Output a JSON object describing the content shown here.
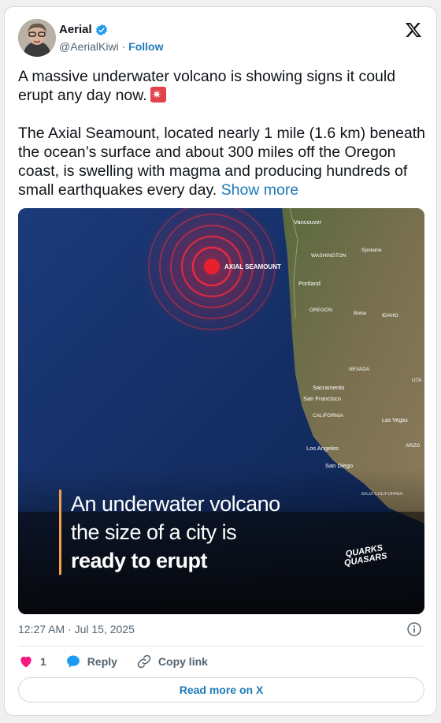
{
  "author": {
    "name": "Aerial",
    "handle": "@AerialKiwi",
    "separator": "·",
    "follow_label": "Follow"
  },
  "post": {
    "paragraph1": "A massive underwater volcano is showing signs it could erupt any day now.",
    "paragraph2": "The Axial Seamount, located nearly 1 mile (1.6 km) beneath the ocean’s surface and about 300 miles off the Oregon coast, is swelling with magma and producing hundreds of small earthquakes every day.",
    "show_more_label": "Show more",
    "timestamp": "12:27 AM · Jul 15, 2025"
  },
  "media": {
    "map_labels": {
      "seamount": "AXIAL SEAMOUNT",
      "vancouver": "Vancouver",
      "washington": "WASHINGTON",
      "spokane": "Spokane",
      "portland": "Portland",
      "oregon": "OREGON",
      "boise": "Boise",
      "idaho": "IDAHO",
      "nevada": "NEVADA",
      "utah": "UTA",
      "sacramento": "Sacramento",
      "san_francisco": "San Francisco",
      "california": "CALIFORNIA",
      "las_vegas": "Las Vegas",
      "arizona": "ARIZO",
      "los_angeles": "Los Angeles",
      "san_diego": "San Diego",
      "baja": "BAJA CALIFORNIA"
    },
    "caption": {
      "line1": "An underwater volcano",
      "line2": "the size of a city is",
      "line3": "ready to erupt"
    },
    "logo_text": {
      "line1": "QUARKS",
      "line2": "QUASARS"
    }
  },
  "actions": {
    "like_count": "1",
    "reply_label": "Reply",
    "copy_link_label": "Copy link",
    "read_more_label": "Read more on X"
  },
  "colors": {
    "link": "#1d7ab8",
    "like": "#f91880",
    "reply": "#1d9bf0",
    "verified": "#1d9bf0",
    "caption_accent": "#f2a04a"
  }
}
